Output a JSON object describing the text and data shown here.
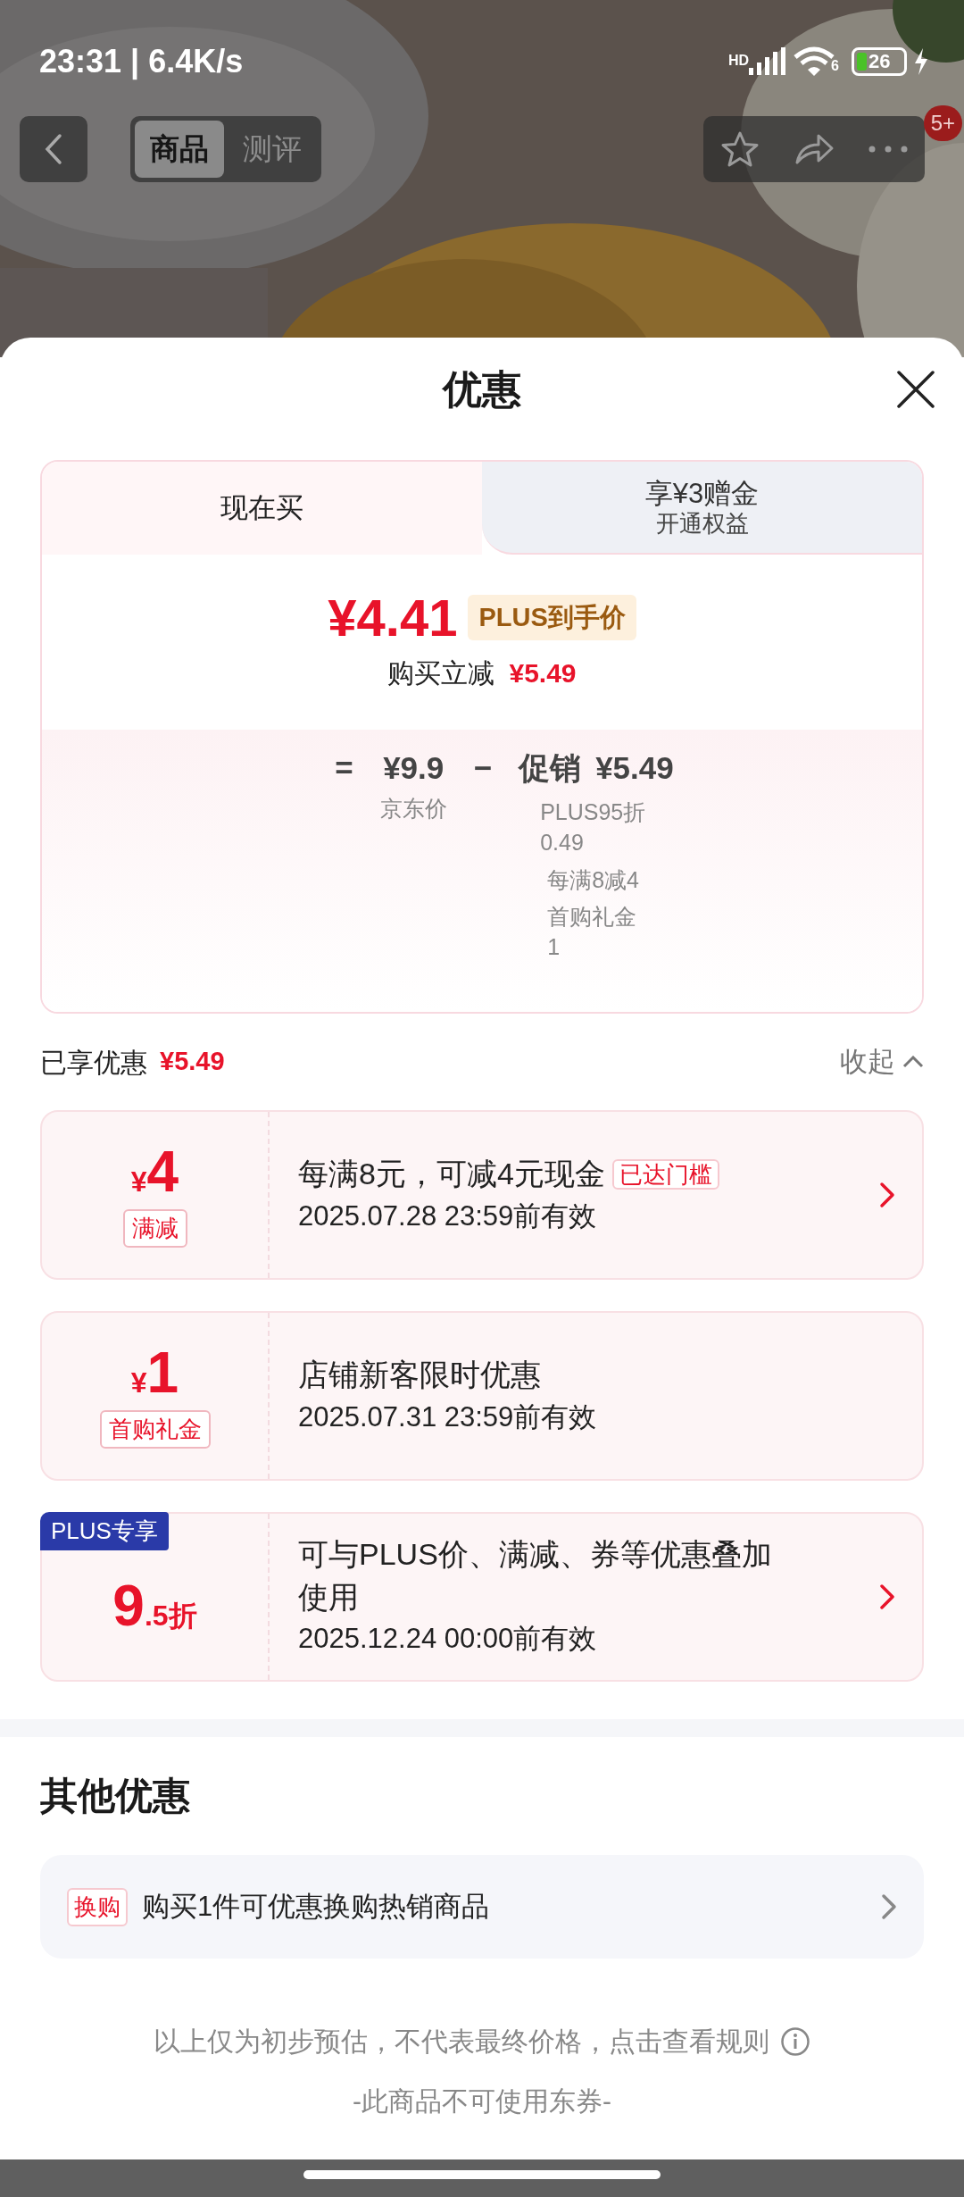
{
  "status_bar": {
    "time": "23:31 | 6.4K/s",
    "network": "HD",
    "wifi_gen": "6",
    "battery": "26"
  },
  "top_nav": {
    "tabs": [
      {
        "label": "商品",
        "selected": true
      },
      {
        "label": "测评",
        "selected": false
      }
    ],
    "badge": "5+"
  },
  "sheet": {
    "title": "优惠"
  },
  "price_tabs": [
    {
      "label": "现在买",
      "selected": true
    },
    {
      "label": "享¥3赠金",
      "sublabel": "开通权益",
      "selected": false
    }
  ],
  "final_price": {
    "amount": "¥4.41",
    "tag": "PLUS到手价",
    "saving_label": "购买立减",
    "saving": "¥5.49"
  },
  "breakdown": {
    "equals": "=",
    "base_price": "¥9.9",
    "base_label": "京东价",
    "minus": "−",
    "promo_label": "促销",
    "promo": "¥5.49",
    "promo_items": [
      {
        "lines": [
          "PLUS95折",
          "0.49"
        ]
      },
      {
        "lines": [
          "每满8减4"
        ]
      },
      {
        "lines": [
          "首购礼金",
          "1"
        ]
      }
    ]
  },
  "summary": {
    "label": "已享优惠",
    "amount": "¥5.49",
    "collapse": "收起"
  },
  "coupons": [
    {
      "kind": "amount",
      "currency": "¥",
      "value": "4",
      "tag": "满减",
      "title": "每满8元，可减4元现金",
      "badge": "已达门槛",
      "validity": "2025.07.28 23:59前有效",
      "has_arrow": true
    },
    {
      "kind": "amount",
      "currency": "¥",
      "value": "1",
      "tag": "首购礼金",
      "title": "店铺新客限时优惠",
      "validity": "2025.07.31 23:59前有效",
      "has_arrow": false
    },
    {
      "kind": "discount",
      "corner": "PLUS专享",
      "value": "9",
      "decimal": ".5折",
      "title": "可与PLUS价、满减、券等优惠叠加使用",
      "validity": "2025.12.24 00:00前有效",
      "has_arrow": true
    }
  ],
  "other_offers": {
    "title": "其他优惠",
    "items": [
      {
        "tag": "换购",
        "text": "购买1件可优惠换购热销商品"
      }
    ]
  },
  "footer": {
    "note": "以上仅为初步预估，不代表最终价格，点击查看规则",
    "coupon_note": "-此商品不可使用东券-"
  }
}
